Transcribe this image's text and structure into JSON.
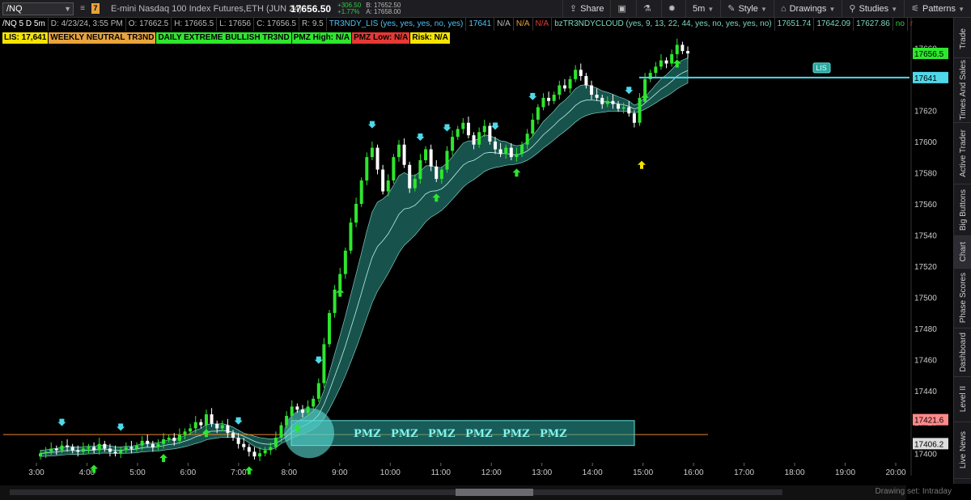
{
  "toolbar": {
    "symbol": "/NQ",
    "link_badge": "7",
    "instrument_name": "E-mini Nasdaq 100 Index Futures,ETH (JUN 24)",
    "last_price": "17656.50",
    "net_change": "+306.50",
    "pct_change": "+1.77%",
    "bid": "B: 17652.50",
    "ask": "A: 17658.00",
    "share_label": "Share",
    "timeframe_label": "5m",
    "style_label": "Style",
    "drawings_label": "Drawings",
    "studies_label": "Studies",
    "patterns_label": "Patterns"
  },
  "study_line": {
    "segments": [
      {
        "text": "/NQ 5 D 5m",
        "color": "#ffffff"
      },
      {
        "text": "D: 4/23/24, 3:55 PM",
        "color": "#bbbbbb"
      },
      {
        "text": "O: 17662.5",
        "color": "#bbbbbb"
      },
      {
        "text": "H: 17665.5",
        "color": "#bbbbbb"
      },
      {
        "text": "L: 17656",
        "color": "#bbbbbb"
      },
      {
        "text": "C: 17656.5",
        "color": "#bbbbbb"
      },
      {
        "text": "R: 9.5",
        "color": "#bbbbbb"
      },
      {
        "text": "TR3NDY_LIS (yes, yes, yes, no, yes)",
        "color": "#4fc3f7"
      },
      {
        "text": "17641",
        "color": "#4fc3f7"
      },
      {
        "text": "N/A",
        "color": "#bbbbbb"
      },
      {
        "text": "N/A",
        "color": "#e8a33c"
      },
      {
        "text": "N/A",
        "color": "#e53935"
      },
      {
        "text": "bzTR3NDYCLOUD (yes, 9, 13, 22, 44, yes, no, yes, yes, no)",
        "color": "#7fd7c4"
      },
      {
        "text": "17651.74",
        "color": "#7fd7c4"
      },
      {
        "text": "17642.09",
        "color": "#7fd7c4"
      },
      {
        "text": "17627.86",
        "color": "#7fd7c4"
      },
      {
        "text": "no",
        "color": "#2ecc40"
      },
      {
        "text": "no",
        "color": "#e53935"
      }
    ]
  },
  "badges": [
    {
      "text": "LIS: 17,641",
      "bg": "#f5e400"
    },
    {
      "text": "WEEKLY NEUTRAL TR3ND",
      "bg": "#e8a33c"
    },
    {
      "text": "DAILY EXTREME BULLISH TR3ND",
      "bg": "#2ee62e"
    },
    {
      "text": "PMZ High: N/A",
      "bg": "#2ee62e"
    },
    {
      "text": "PMZ Low: N/A",
      "bg": "#e53935"
    },
    {
      "text": "Risk: N/A",
      "bg": "#f5e400"
    }
  ],
  "right_tabs": [
    "Trade",
    "Times And Sales",
    "Active Trader",
    "Big Buttons",
    "Chart",
    "Phase Scores",
    "Dashboard",
    "Level II",
    "Live News"
  ],
  "footer": {
    "drawing_set": "Drawing set: Intraday"
  },
  "colors": {
    "bull": "#2ee62e",
    "bear": "#ffffff",
    "cloud": "#1f6f66",
    "lis_line": "#4fd8e8",
    "orange_line": "#e8852c",
    "up_arrow": "#2ee62e",
    "down_arrow": "#4fd8e8"
  },
  "chart_data": {
    "type": "candlestick",
    "x_ticks": [
      "3:00",
      "4:00",
      "5:00",
      "6:00",
      "7:00",
      "8:00",
      "9:00",
      "10:00",
      "11:00",
      "12:00",
      "13:00",
      "14:00",
      "15:00",
      "16:00",
      "17:00",
      "18:00",
      "19:00",
      "20:00"
    ],
    "y_ticks": [
      17400,
      17420,
      17440,
      17460,
      17480,
      17500,
      17520,
      17540,
      17560,
      17580,
      17600,
      17620,
      17640,
      17660
    ],
    "ylim": [
      17396,
      17670
    ],
    "price_labels": [
      {
        "value": 17656.5,
        "text": "17656.5",
        "color": "#2ee62e"
      },
      {
        "value": 17641,
        "text": "17641",
        "color": "#4fd8e8"
      },
      {
        "value": 17421.6,
        "text": "17421.6",
        "color": "#ff8a8a"
      },
      {
        "value": 17406.2,
        "text": "17406.2",
        "color": "#dddddd"
      }
    ],
    "lis_level": 17641,
    "lis_label": "LIS",
    "orange_levels": [
      17412,
      17624
    ],
    "pmz_zone": {
      "low": 17405,
      "high": 17421,
      "label": "PMZ",
      "repeat": 6
    },
    "series_close": [
      17400,
      17401,
      17403,
      17402,
      17405,
      17404,
      17402,
      17401,
      17403,
      17404,
      17402,
      17406,
      17403,
      17401,
      17400,
      17402,
      17404,
      17403,
      17405,
      17408,
      17406,
      17404,
      17406,
      17409,
      17410,
      17408,
      17412,
      17414,
      17416,
      17420,
      17418,
      17425,
      17419,
      17416,
      17418,
      17413,
      17410,
      17406,
      17404,
      17401,
      17398,
      17400,
      17402,
      17404,
      17410,
      17418,
      17424,
      17430,
      17428,
      17426,
      17430,
      17435,
      17445,
      17470,
      17490,
      17505,
      17515,
      17530,
      17548,
      17560,
      17575,
      17590,
      17596,
      17582,
      17568,
      17575,
      17590,
      17598,
      17585,
      17570,
      17576,
      17588,
      17595,
      17584,
      17576,
      17582,
      17594,
      17603,
      17608,
      17612,
      17604,
      17598,
      17606,
      17610,
      17600,
      17595,
      17592,
      17596,
      17590,
      17592,
      17598,
      17605,
      17614,
      17622,
      17628,
      17626,
      17630,
      17636,
      17634,
      17640,
      17646,
      17642,
      17636,
      17630,
      17628,
      17624,
      17626,
      17624,
      17621,
      17622,
      17618,
      17612,
      17628,
      17640,
      17644,
      17648,
      17652,
      17650,
      17656,
      17662,
      17658,
      17656.5
    ]
  }
}
